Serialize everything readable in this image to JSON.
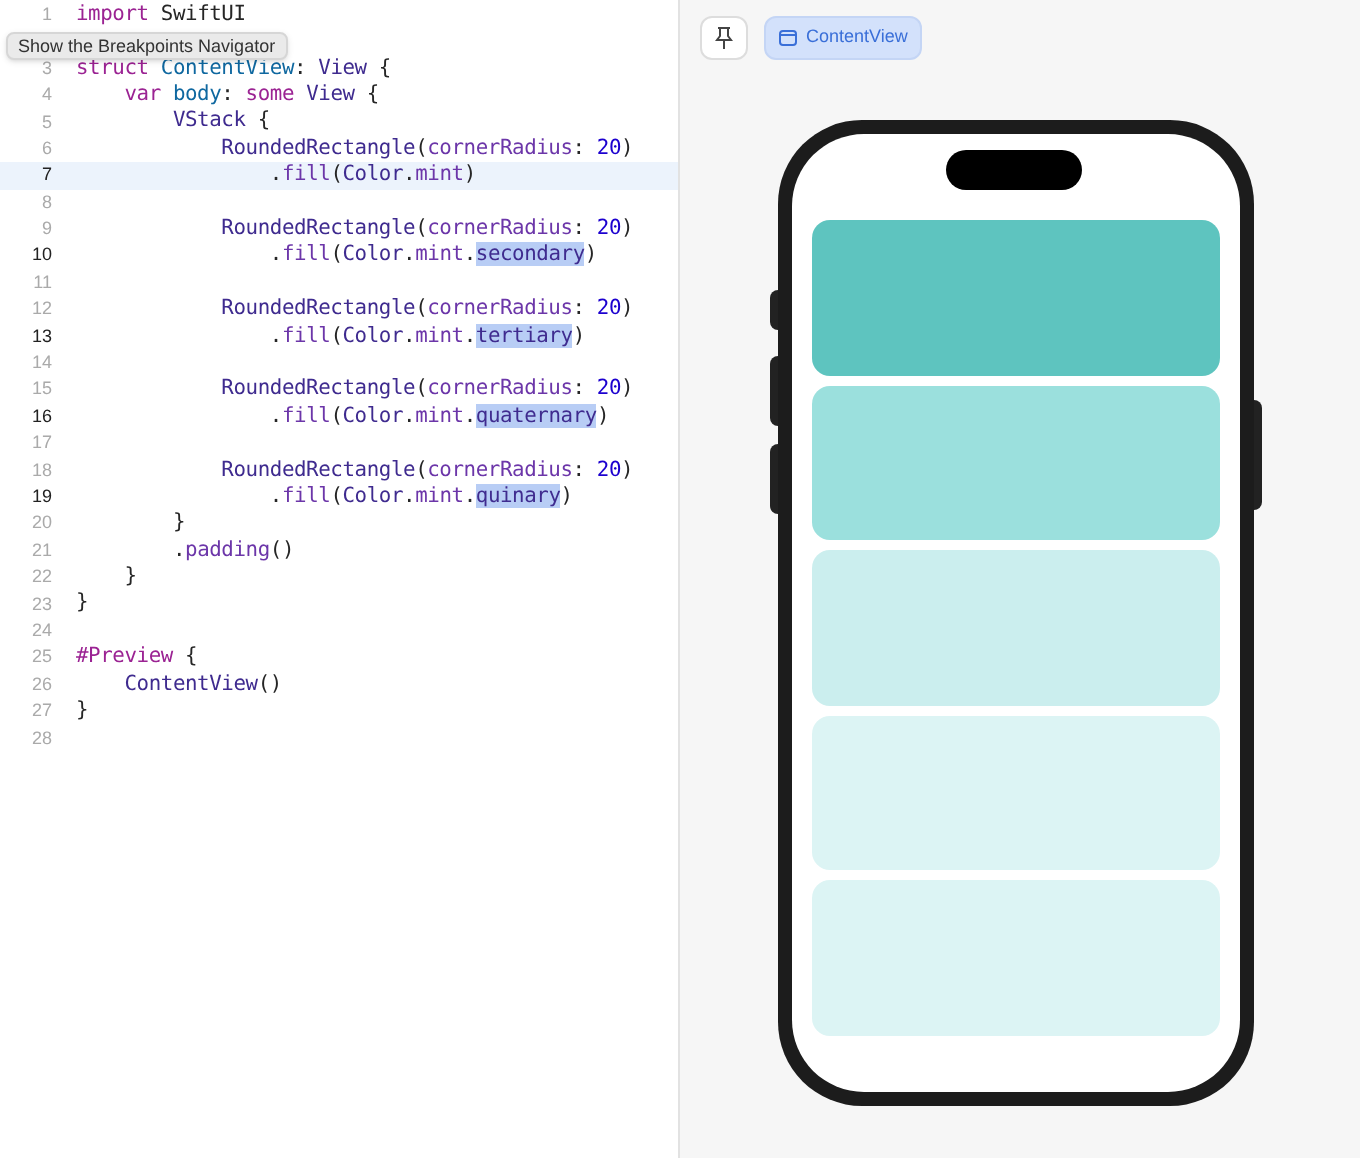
{
  "editor": {
    "lines": [
      {
        "number": "1",
        "current": false,
        "strong": false,
        "tokens": [
          {
            "kind": "keyword",
            "text": "import"
          },
          {
            "kind": "plain",
            "text": " SwiftUI"
          }
        ]
      },
      {
        "current": false
      },
      {
        "number": "3",
        "current": false,
        "strong": false,
        "tokens": [
          {
            "kind": "keyword",
            "text": "struct"
          },
          {
            "kind": "decl",
            "text": " ContentView"
          },
          {
            "kind": "plain",
            "text": ": "
          },
          {
            "kind": "type",
            "text": "View"
          },
          {
            "kind": "plain",
            "text": " {"
          }
        ]
      },
      {
        "number": "4",
        "current": false,
        "strong": false,
        "tokens": [
          {
            "kind": "keyword",
            "text": "    var"
          },
          {
            "kind": "decl",
            "text": " body"
          },
          {
            "kind": "plain",
            "text": ": "
          },
          {
            "kind": "keyword",
            "text": "some"
          },
          {
            "kind": "type",
            "text": " View"
          },
          {
            "kind": "plain",
            "text": " {"
          }
        ]
      },
      {
        "number": "5",
        "current": false,
        "strong": false,
        "tokens": [
          {
            "kind": "type",
            "text": "        VStack"
          },
          {
            "kind": "plain",
            "text": " {"
          }
        ]
      },
      {
        "number": "6",
        "current": false,
        "strong": false,
        "tokens": [
          {
            "kind": "type",
            "text": "            RoundedRectangle"
          },
          {
            "kind": "plain",
            "text": "("
          },
          {
            "kind": "member",
            "text": "cornerRadius"
          },
          {
            "kind": "plain",
            "text": ": "
          },
          {
            "kind": "number",
            "text": "20"
          },
          {
            "kind": "plain",
            "text": ")"
          }
        ]
      },
      {
        "number": "7",
        "current": true,
        "strong": true,
        "tokens": [
          {
            "kind": "plain",
            "text": "                ."
          },
          {
            "kind": "member",
            "text": "fill"
          },
          {
            "kind": "plain",
            "text": "("
          },
          {
            "kind": "type",
            "text": "Color"
          },
          {
            "kind": "plain",
            "text": "."
          },
          {
            "kind": "member",
            "text": "mint"
          },
          {
            "kind": "plain",
            "text": ")"
          }
        ]
      },
      {
        "number": "8",
        "current": false,
        "strong": false
      },
      {
        "number": "9",
        "current": false,
        "strong": false,
        "tokens": [
          {
            "kind": "type",
            "text": "            RoundedRectangle"
          },
          {
            "kind": "plain",
            "text": "("
          },
          {
            "kind": "member",
            "text": "cornerRadius"
          },
          {
            "kind": "plain",
            "text": ": "
          },
          {
            "kind": "number",
            "text": "20"
          },
          {
            "kind": "plain",
            "text": ")"
          }
        ]
      },
      {
        "number": "10",
        "current": false,
        "strong": true,
        "tokens": [
          {
            "kind": "plain",
            "text": "                ."
          },
          {
            "kind": "member",
            "text": "fill"
          },
          {
            "kind": "plain",
            "text": "("
          },
          {
            "kind": "type",
            "text": "Color"
          },
          {
            "kind": "plain",
            "text": "."
          },
          {
            "kind": "member",
            "text": "mint"
          },
          {
            "kind": "plain",
            "text": "."
          },
          {
            "kind": "match",
            "text": "secondary"
          },
          {
            "kind": "plain",
            "text": ")"
          }
        ]
      },
      {
        "number": "11",
        "current": false,
        "strong": false
      },
      {
        "number": "12",
        "current": false,
        "strong": false,
        "tokens": [
          {
            "kind": "type",
            "text": "            RoundedRectangle"
          },
          {
            "kind": "plain",
            "text": "("
          },
          {
            "kind": "member",
            "text": "cornerRadius"
          },
          {
            "kind": "plain",
            "text": ": "
          },
          {
            "kind": "number",
            "text": "20"
          },
          {
            "kind": "plain",
            "text": ")"
          }
        ]
      },
      {
        "number": "13",
        "current": false,
        "strong": true,
        "tokens": [
          {
            "kind": "plain",
            "text": "                ."
          },
          {
            "kind": "member",
            "text": "fill"
          },
          {
            "kind": "plain",
            "text": "("
          },
          {
            "kind": "type",
            "text": "Color"
          },
          {
            "kind": "plain",
            "text": "."
          },
          {
            "kind": "member",
            "text": "mint"
          },
          {
            "kind": "plain",
            "text": "."
          },
          {
            "kind": "match",
            "text": "tertiary"
          },
          {
            "kind": "plain",
            "text": ")"
          }
        ]
      },
      {
        "number": "14",
        "current": false,
        "strong": false
      },
      {
        "number": "15",
        "current": false,
        "strong": false,
        "tokens": [
          {
            "kind": "type",
            "text": "            RoundedRectangle"
          },
          {
            "kind": "plain",
            "text": "("
          },
          {
            "kind": "member",
            "text": "cornerRadius"
          },
          {
            "kind": "plain",
            "text": ": "
          },
          {
            "kind": "number",
            "text": "20"
          },
          {
            "kind": "plain",
            "text": ")"
          }
        ]
      },
      {
        "number": "16",
        "current": false,
        "strong": true,
        "tokens": [
          {
            "kind": "plain",
            "text": "                ."
          },
          {
            "kind": "member",
            "text": "fill"
          },
          {
            "kind": "plain",
            "text": "("
          },
          {
            "kind": "type",
            "text": "Color"
          },
          {
            "kind": "plain",
            "text": "."
          },
          {
            "kind": "member",
            "text": "mint"
          },
          {
            "kind": "plain",
            "text": "."
          },
          {
            "kind": "match",
            "text": "quaternary"
          },
          {
            "kind": "plain",
            "text": ")"
          }
        ]
      },
      {
        "number": "17",
        "current": false,
        "strong": false
      },
      {
        "number": "18",
        "current": false,
        "strong": false,
        "tokens": [
          {
            "kind": "type",
            "text": "            RoundedRectangle"
          },
          {
            "kind": "plain",
            "text": "("
          },
          {
            "kind": "member",
            "text": "cornerRadius"
          },
          {
            "kind": "plain",
            "text": ": "
          },
          {
            "kind": "number",
            "text": "20"
          },
          {
            "kind": "plain",
            "text": ")"
          }
        ]
      },
      {
        "number": "19",
        "current": false,
        "strong": true,
        "tokens": [
          {
            "kind": "plain",
            "text": "                ."
          },
          {
            "kind": "member",
            "text": "fill"
          },
          {
            "kind": "plain",
            "text": "("
          },
          {
            "kind": "type",
            "text": "Color"
          },
          {
            "kind": "plain",
            "text": "."
          },
          {
            "kind": "member",
            "text": "mint"
          },
          {
            "kind": "plain",
            "text": "."
          },
          {
            "kind": "match",
            "text": "quinary"
          },
          {
            "kind": "plain",
            "text": ")"
          }
        ]
      },
      {
        "number": "20",
        "current": false,
        "strong": false,
        "tokens": [
          {
            "kind": "plain",
            "text": "        }"
          }
        ]
      },
      {
        "number": "21",
        "current": false,
        "strong": false,
        "tokens": [
          {
            "kind": "plain",
            "text": "        ."
          },
          {
            "kind": "member",
            "text": "padding"
          },
          {
            "kind": "plain",
            "text": "()"
          }
        ]
      },
      {
        "number": "22",
        "current": false,
        "strong": false,
        "tokens": [
          {
            "kind": "plain",
            "text": "    }"
          }
        ]
      },
      {
        "number": "23",
        "current": false,
        "strong": false,
        "tokens": [
          {
            "kind": "plain",
            "text": "}"
          }
        ]
      },
      {
        "number": "24",
        "current": false,
        "strong": false
      },
      {
        "number": "25",
        "current": false,
        "strong": false,
        "tokens": [
          {
            "kind": "keyword",
            "text": "#Preview"
          },
          {
            "kind": "plain",
            "text": " {"
          }
        ]
      },
      {
        "number": "26",
        "current": false,
        "strong": false,
        "tokens": [
          {
            "kind": "type",
            "text": "    ContentView"
          },
          {
            "kind": "plain",
            "text": "()"
          }
        ]
      },
      {
        "number": "27",
        "current": false,
        "strong": false,
        "tokens": [
          {
            "kind": "plain",
            "text": "}"
          }
        ]
      },
      {
        "number": "28",
        "current": false,
        "strong": false
      }
    ]
  },
  "tooltip": "Show the Breakpoints Navigator",
  "preview": {
    "toolbar": [
      {
        "kind": "pin",
        "selected": false
      },
      {
        "kind": "view",
        "label": "ContentView",
        "selected": true
      }
    ],
    "rectangles": [
      {
        "color": "#5ec4bf"
      },
      {
        "color": "#9be0dd"
      },
      {
        "color": "#cbeeee"
      },
      {
        "color": "#dcf4f4"
      },
      {
        "color": "#dcf4f4"
      }
    ]
  }
}
